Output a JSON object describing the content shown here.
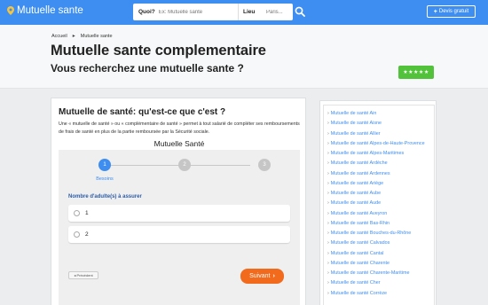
{
  "header": {
    "brand": "Mutuelle sante",
    "search_label": "Quoi?",
    "search_placeholder": "Ex: Mutuelle sante",
    "location_label": "Lieu",
    "location_placeholder": "Paris...",
    "devis_label": "Devis gratuit",
    "accent": "#3d8ef0"
  },
  "hero": {
    "breadcrumb": [
      "Accueil",
      "Mutuelle sante"
    ],
    "title": "Mutuelle sante complementaire",
    "subtitle": "Vous recherchez une mutuelle sante ?",
    "rating": "★★★★★"
  },
  "main": {
    "title": "Mutuelle de santé: qu'est-ce que c'est ?",
    "text": "Une « mutuelle de santé » ou « complémentaire de santé » permet à tout salarié de compléter ses remboursements de frais de santé en plus de la partie remboursée par la Sécurité sociale.",
    "widget_title": "Mutuelle Santé",
    "steps": [
      "1",
      "2",
      "3"
    ],
    "step_label": "Besoins",
    "question": "Nombre d'adulte(s) à assurer",
    "options": [
      "1",
      "2"
    ],
    "prev_label": "Précédent",
    "next_label": "Suivant",
    "next_color": "#f26a1b"
  },
  "sidebar": {
    "items": [
      "Mutuelle de santé Ain",
      "Mutuelle de santé Aisne",
      "Mutuelle de santé Allier",
      "Mutuelle de santé Alpes-de-Haute-Provence",
      "Mutuelle de santé Alpes-Maritimes",
      "Mutuelle de santé Ardèche",
      "Mutuelle de santé Ardennes",
      "Mutuelle de santé Ariège",
      "Mutuelle de santé Aube",
      "Mutuelle de santé Aude",
      "Mutuelle de santé Aveyron",
      "Mutuelle de santé Bas-Rhin",
      "Mutuelle de santé Bouches-du-Rhône",
      "Mutuelle de santé Calvados",
      "Mutuelle de santé Cantal",
      "Mutuelle de santé Charente",
      "Mutuelle de santé Charente-Maritime",
      "Mutuelle de santé Cher",
      "Mutuelle de santé Corrèze"
    ]
  }
}
